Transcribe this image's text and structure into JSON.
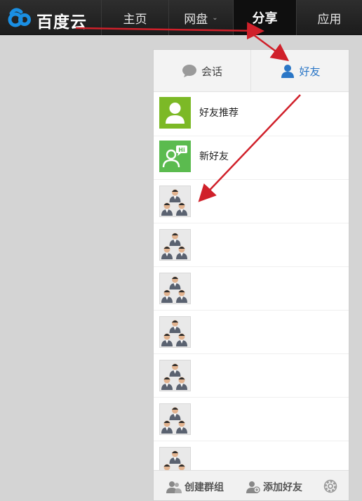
{
  "brand": {
    "name": "百度云",
    "accent_color": "#1a8fe3"
  },
  "nav": {
    "items": [
      {
        "label": "主页",
        "active": false
      },
      {
        "label": "网盘",
        "active": false,
        "has_dropdown": true
      },
      {
        "label": "分享",
        "active": true
      },
      {
        "label": "应用",
        "active": false
      }
    ]
  },
  "panel": {
    "tabs": [
      {
        "label": "会话",
        "icon": "chat-bubble-icon",
        "active": false
      },
      {
        "label": "好友",
        "icon": "person-icon",
        "active": true,
        "color": "#2a76c6"
      }
    ],
    "special_rows": [
      {
        "label": "好友推荐",
        "icon": "friend-recommend-icon",
        "color": "#7cb926"
      },
      {
        "label": "新好友",
        "icon": "new-friend-icon",
        "color": "#5bbb4f"
      }
    ],
    "friend_rows": [
      {
        "avatar": "group-avatar"
      },
      {
        "avatar": "group-avatar"
      },
      {
        "avatar": "group-avatar"
      },
      {
        "avatar": "group-avatar"
      },
      {
        "avatar": "group-avatar"
      },
      {
        "avatar": "group-avatar"
      },
      {
        "avatar": "group-avatar"
      }
    ],
    "bottom": {
      "create_group": "创建群组",
      "add_friend": "添加好友",
      "settings_icon": "gear-icon"
    }
  },
  "annotation_color": "#d0202a"
}
